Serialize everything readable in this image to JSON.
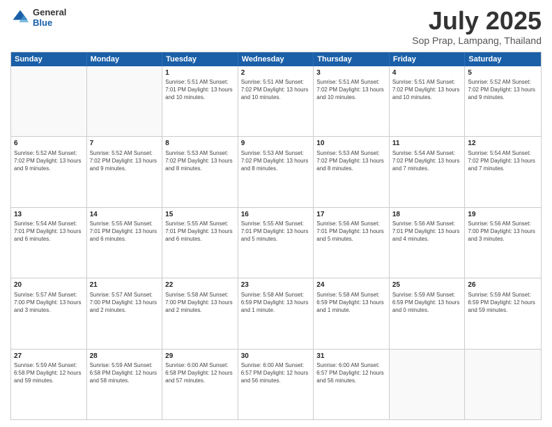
{
  "logo": {
    "general": "General",
    "blue": "Blue"
  },
  "header": {
    "title": "July 2025",
    "location": "Sop Prap, Lampang, Thailand"
  },
  "days": [
    "Sunday",
    "Monday",
    "Tuesday",
    "Wednesday",
    "Thursday",
    "Friday",
    "Saturday"
  ],
  "weeks": [
    [
      {
        "day": "",
        "detail": ""
      },
      {
        "day": "",
        "detail": ""
      },
      {
        "day": "1",
        "detail": "Sunrise: 5:51 AM\nSunset: 7:01 PM\nDaylight: 13 hours\nand 10 minutes."
      },
      {
        "day": "2",
        "detail": "Sunrise: 5:51 AM\nSunset: 7:02 PM\nDaylight: 13 hours\nand 10 minutes."
      },
      {
        "day": "3",
        "detail": "Sunrise: 5:51 AM\nSunset: 7:02 PM\nDaylight: 13 hours\nand 10 minutes."
      },
      {
        "day": "4",
        "detail": "Sunrise: 5:51 AM\nSunset: 7:02 PM\nDaylight: 13 hours\nand 10 minutes."
      },
      {
        "day": "5",
        "detail": "Sunrise: 5:52 AM\nSunset: 7:02 PM\nDaylight: 13 hours\nand 9 minutes."
      }
    ],
    [
      {
        "day": "6",
        "detail": "Sunrise: 5:52 AM\nSunset: 7:02 PM\nDaylight: 13 hours\nand 9 minutes."
      },
      {
        "day": "7",
        "detail": "Sunrise: 5:52 AM\nSunset: 7:02 PM\nDaylight: 13 hours\nand 9 minutes."
      },
      {
        "day": "8",
        "detail": "Sunrise: 5:53 AM\nSunset: 7:02 PM\nDaylight: 13 hours\nand 8 minutes."
      },
      {
        "day": "9",
        "detail": "Sunrise: 5:53 AM\nSunset: 7:02 PM\nDaylight: 13 hours\nand 8 minutes."
      },
      {
        "day": "10",
        "detail": "Sunrise: 5:53 AM\nSunset: 7:02 PM\nDaylight: 13 hours\nand 8 minutes."
      },
      {
        "day": "11",
        "detail": "Sunrise: 5:54 AM\nSunset: 7:02 PM\nDaylight: 13 hours\nand 7 minutes."
      },
      {
        "day": "12",
        "detail": "Sunrise: 5:54 AM\nSunset: 7:02 PM\nDaylight: 13 hours\nand 7 minutes."
      }
    ],
    [
      {
        "day": "13",
        "detail": "Sunrise: 5:54 AM\nSunset: 7:01 PM\nDaylight: 13 hours\nand 6 minutes."
      },
      {
        "day": "14",
        "detail": "Sunrise: 5:55 AM\nSunset: 7:01 PM\nDaylight: 13 hours\nand 6 minutes."
      },
      {
        "day": "15",
        "detail": "Sunrise: 5:55 AM\nSunset: 7:01 PM\nDaylight: 13 hours\nand 6 minutes."
      },
      {
        "day": "16",
        "detail": "Sunrise: 5:55 AM\nSunset: 7:01 PM\nDaylight: 13 hours\nand 5 minutes."
      },
      {
        "day": "17",
        "detail": "Sunrise: 5:56 AM\nSunset: 7:01 PM\nDaylight: 13 hours\nand 5 minutes."
      },
      {
        "day": "18",
        "detail": "Sunrise: 5:56 AM\nSunset: 7:01 PM\nDaylight: 13 hours\nand 4 minutes."
      },
      {
        "day": "19",
        "detail": "Sunrise: 5:56 AM\nSunset: 7:00 PM\nDaylight: 13 hours\nand 3 minutes."
      }
    ],
    [
      {
        "day": "20",
        "detail": "Sunrise: 5:57 AM\nSunset: 7:00 PM\nDaylight: 13 hours\nand 3 minutes."
      },
      {
        "day": "21",
        "detail": "Sunrise: 5:57 AM\nSunset: 7:00 PM\nDaylight: 13 hours\nand 2 minutes."
      },
      {
        "day": "22",
        "detail": "Sunrise: 5:58 AM\nSunset: 7:00 PM\nDaylight: 13 hours\nand 2 minutes."
      },
      {
        "day": "23",
        "detail": "Sunrise: 5:58 AM\nSunset: 6:59 PM\nDaylight: 13 hours\nand 1 minute."
      },
      {
        "day": "24",
        "detail": "Sunrise: 5:58 AM\nSunset: 6:59 PM\nDaylight: 13 hours\nand 1 minute."
      },
      {
        "day": "25",
        "detail": "Sunrise: 5:59 AM\nSunset: 6:59 PM\nDaylight: 13 hours\nand 0 minutes."
      },
      {
        "day": "26",
        "detail": "Sunrise: 5:59 AM\nSunset: 6:59 PM\nDaylight: 12 hours\nand 59 minutes."
      }
    ],
    [
      {
        "day": "27",
        "detail": "Sunrise: 5:59 AM\nSunset: 6:58 PM\nDaylight: 12 hours\nand 59 minutes."
      },
      {
        "day": "28",
        "detail": "Sunrise: 5:59 AM\nSunset: 6:58 PM\nDaylight: 12 hours\nand 58 minutes."
      },
      {
        "day": "29",
        "detail": "Sunrise: 6:00 AM\nSunset: 6:58 PM\nDaylight: 12 hours\nand 57 minutes."
      },
      {
        "day": "30",
        "detail": "Sunrise: 6:00 AM\nSunset: 6:57 PM\nDaylight: 12 hours\nand 56 minutes."
      },
      {
        "day": "31",
        "detail": "Sunrise: 6:00 AM\nSunset: 6:57 PM\nDaylight: 12 hours\nand 56 minutes."
      },
      {
        "day": "",
        "detail": ""
      },
      {
        "day": "",
        "detail": ""
      }
    ]
  ]
}
